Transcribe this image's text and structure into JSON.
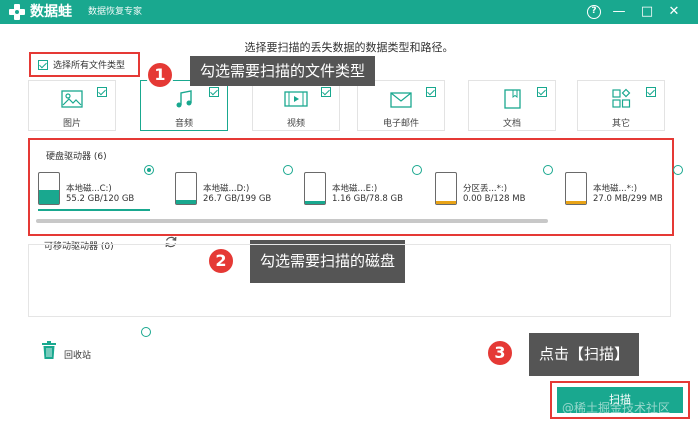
{
  "titlebar": {
    "app_name": "数据蛙",
    "subtitle": "数据恢复专家",
    "help_label": "?",
    "minimize_label": "—",
    "maximize_label": "□",
    "close_label": "✕"
  },
  "heading": "选择要扫描的丢失数据的数据类型和路径。",
  "select_all_label": "选择所有文件类型",
  "file_types": [
    {
      "label": "图片",
      "icon": "picture-icon",
      "checked": true
    },
    {
      "label": "音频",
      "icon": "audio-icon",
      "checked": true
    },
    {
      "label": "视频",
      "icon": "video-icon",
      "checked": true
    },
    {
      "label": "电子邮件",
      "icon": "email-icon",
      "checked": true
    },
    {
      "label": "文档",
      "icon": "document-icon",
      "checked": true
    },
    {
      "label": "其它",
      "icon": "other-icon",
      "checked": true
    }
  ],
  "callouts": [
    {
      "num": "1",
      "text": "勾选需要扫描的文件类型"
    },
    {
      "num": "2",
      "text": "勾选需要扫描的磁盘"
    },
    {
      "num": "3",
      "text": "点击【扫描】"
    }
  ],
  "hard_drives": {
    "title": "硬盘驱动器 (6)",
    "items": [
      {
        "name": "本地磁...C:)",
        "size": "55.2 GB/120 GB",
        "used_fraction": 0.46,
        "color": "#19a88f",
        "selected": true
      },
      {
        "name": "本地磁...D:)",
        "size": "26.7 GB/199 GB",
        "used_fraction": 0.13,
        "color": "#19a88f",
        "selected": false
      },
      {
        "name": "本地磁...E:)",
        "size": "1.16 GB/78.8 GB",
        "used_fraction": 0.02,
        "color": "#19a88f",
        "selected": false
      },
      {
        "name": "分区丢...*:)",
        "size": "0.00  B/128 MB",
        "used_fraction": 0.0,
        "color": "#e8a317",
        "selected": false
      },
      {
        "name": "本地磁...*:)",
        "size": "27.0 MB/299 MB",
        "used_fraction": 0.09,
        "color": "#e8a317",
        "selected": false
      }
    ]
  },
  "removable": {
    "title": "可移动驱动器 (0)"
  },
  "recycle_bin_label": "回收站",
  "scan_label": "扫描",
  "watermark": "@稀土掘金技术社区",
  "colors": {
    "accent": "#19a88f",
    "highlight": "#e53935",
    "callout_bg": "#555555"
  }
}
